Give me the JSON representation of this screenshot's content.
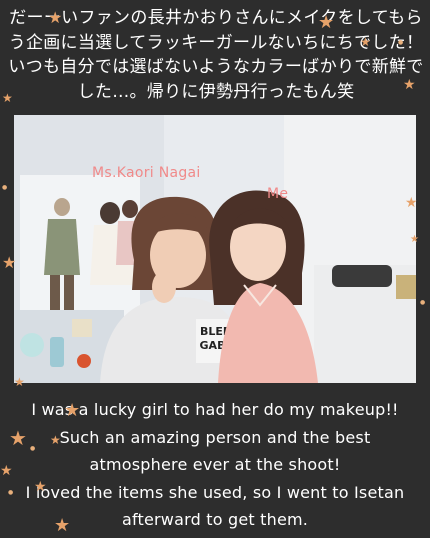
{
  "caption_jp": "だーーいファンの長井かおりさんにメイクをしてもらう企画に当選してラッキーガールないちにちでした！いつも自分では選ばないようなカラーばかりで新鮮でした…。帰りに伊勢丹行ったもん笑",
  "photo": {
    "label_left": "Ms.Kaori Nagai",
    "label_right": "Me",
    "sweatshirt_text": "BLED GABL"
  },
  "caption_en": [
    "I was a lucky girl to had her do my makeup!!",
    "Such an amazing person and the best",
    "atmosphere ever at the shoot!",
    "I loved the items she used, so I went to Isetan",
    "afterward to get them."
  ],
  "colors": {
    "background": "#2d2d2d",
    "star": "#e6a26a",
    "label": "#f08a8a"
  }
}
